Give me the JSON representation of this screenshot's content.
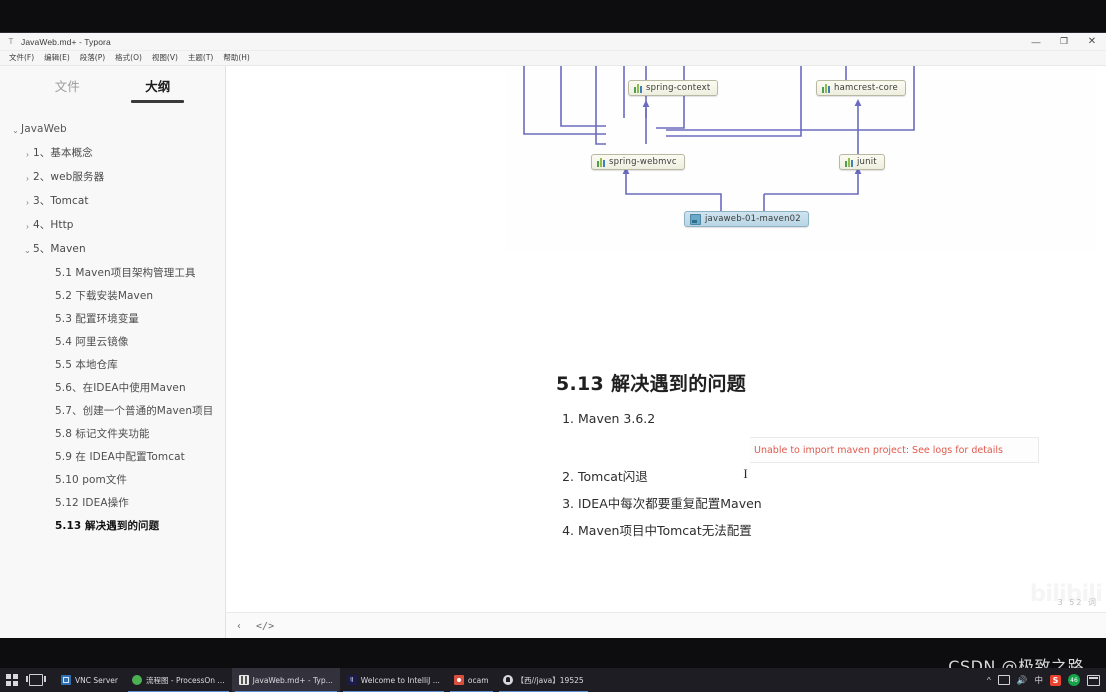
{
  "window": {
    "title": "JavaWeb.md+ - Typora",
    "app_icon": "typora-icon",
    "controls": {
      "minimize": "—",
      "restore": "❐",
      "close": "✕"
    }
  },
  "menu": {
    "items": [
      {
        "label": "文件(F)",
        "name": "menu-file"
      },
      {
        "label": "编辑(E)",
        "name": "menu-edit"
      },
      {
        "label": "段落(P)",
        "name": "menu-paragraph"
      },
      {
        "label": "格式(O)",
        "name": "menu-format"
      },
      {
        "label": "视图(V)",
        "name": "menu-view"
      },
      {
        "label": "主题(T)",
        "name": "menu-theme"
      },
      {
        "label": "帮助(H)",
        "name": "menu-help"
      }
    ]
  },
  "sidebar": {
    "tabs": [
      {
        "label": "文件",
        "active": false
      },
      {
        "label": "大纲",
        "active": true
      }
    ],
    "outline": [
      {
        "label": "JavaWeb",
        "level": 0,
        "arrow": "v",
        "selected": false
      },
      {
        "label": "1、基本概念",
        "level": 1,
        "arrow": ">",
        "selected": false
      },
      {
        "label": "2、web服务器",
        "level": 1,
        "arrow": ">",
        "selected": false
      },
      {
        "label": "3、Tomcat",
        "level": 1,
        "arrow": ">",
        "selected": false
      },
      {
        "label": "4、Http",
        "level": 1,
        "arrow": ">",
        "selected": false
      },
      {
        "label": "5、Maven",
        "level": 1,
        "arrow": "v",
        "selected": false
      },
      {
        "label": "5.1 Maven项目架构管理工具",
        "level": 2,
        "arrow": "",
        "selected": false
      },
      {
        "label": "5.2 下载安装Maven",
        "level": 2,
        "arrow": "",
        "selected": false
      },
      {
        "label": "5.3 配置环境变量",
        "level": 2,
        "arrow": "",
        "selected": false
      },
      {
        "label": "5.4 阿里云镜像",
        "level": 2,
        "arrow": "",
        "selected": false
      },
      {
        "label": "5.5 本地仓库",
        "level": 2,
        "arrow": "",
        "selected": false
      },
      {
        "label": "5.6、在IDEA中使用Maven",
        "level": 2,
        "arrow": "",
        "selected": false
      },
      {
        "label": "5.7、创建一个普通的Maven项目",
        "level": 2,
        "arrow": "",
        "selected": false
      },
      {
        "label": "5.8 标记文件夹功能",
        "level": 2,
        "arrow": "",
        "selected": false
      },
      {
        "label": "5.9 在 IDEA中配置Tomcat",
        "level": 2,
        "arrow": "",
        "selected": false
      },
      {
        "label": "5.10 pom文件",
        "level": 2,
        "arrow": "",
        "selected": false
      },
      {
        "label": "5.12 IDEA操作",
        "level": 2,
        "arrow": "",
        "selected": false
      },
      {
        "label": "5.13 解决遇到的问题",
        "level": 2,
        "arrow": "",
        "selected": true
      }
    ]
  },
  "document": {
    "heading": "5.13 解决遇到的问题",
    "list": [
      "Maven 3.6.2",
      "Tomcat闪退",
      "IDEA中每次都要重复配置Maven",
      "Maven项目中Tomcat无法配置"
    ],
    "error_note": "Unable to import maven project: See logs for details",
    "diagram": {
      "nodes": [
        {
          "label": "spring-context",
          "kind": "jar"
        },
        {
          "label": "hamcrest-core",
          "kind": "jar"
        },
        {
          "label": "spring-webmvc",
          "kind": "jar"
        },
        {
          "label": "junit",
          "kind": "jar"
        },
        {
          "label": "javaweb-01-maven02",
          "kind": "project"
        }
      ],
      "edge_color": "#6b6bbf"
    },
    "watermark_bilibili": "bilibili",
    "word_count": "3 52 词"
  },
  "statusbar": {
    "collapse_icon": "‹",
    "source_icon": "</>"
  },
  "taskbar": {
    "start": "start-icon",
    "task_view": "task-view-icon",
    "items": [
      {
        "label": "VNC Server",
        "icon": "vnc",
        "active": false,
        "underline": false
      },
      {
        "label": "流程图 - ProcessOn ...",
        "icon": "pon",
        "active": false,
        "underline": true
      },
      {
        "label": "JavaWeb.md+ - Typ...",
        "icon": "typ",
        "active": true,
        "underline": true
      },
      {
        "label": "Welcome to IntelliJ ...",
        "icon": "idea",
        "active": false,
        "underline": true
      },
      {
        "label": "ocam",
        "icon": "ocam",
        "active": false,
        "underline": true
      },
      {
        "label": "【西//java】19525",
        "icon": "chat",
        "active": false,
        "underline": true
      }
    ],
    "tray": [
      {
        "name": "chevron-up-icon",
        "glyph": "^"
      },
      {
        "name": "display-icon",
        "glyph": ""
      },
      {
        "name": "volume-icon",
        "glyph": "◀))"
      },
      {
        "name": "ime-icon",
        "glyph": "中"
      },
      {
        "name": "sogou-icon",
        "glyph": "S"
      },
      {
        "name": "green-badge-icon",
        "glyph": "46"
      },
      {
        "name": "monitor-icon",
        "glyph": ""
      }
    ]
  },
  "watermark": {
    "text": "CSDN @极致之路"
  }
}
